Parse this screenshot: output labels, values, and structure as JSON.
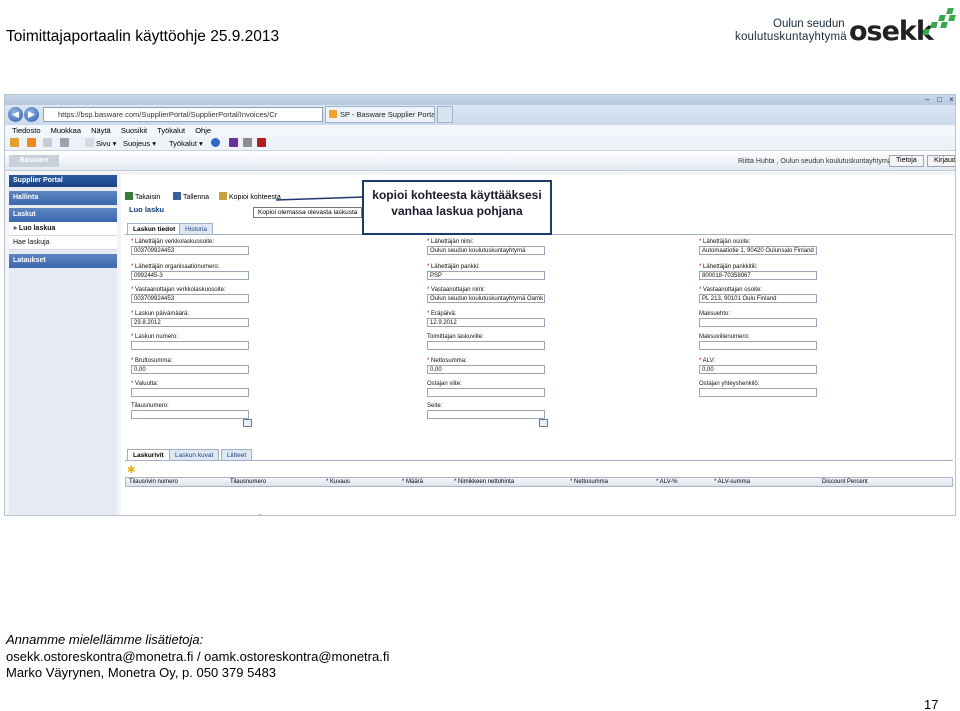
{
  "slide": {
    "header_title": "Toimittajaportaalin käyttöohje 25.9.2013",
    "logo_line1": "Oulun seudun",
    "logo_line2": "koulutuskuntayhtymä",
    "logo_mark": "osekk",
    "callout_line1": "kopioi kohteesta käyttääksesi",
    "callout_line2": "vanhaa laskua pohjana",
    "footer_line1": "Annamme mielellämme lisätietoja:",
    "footer_line2": "osekk.ostoreskontra@monetra.fi  / oamk.ostoreskontra@monetra.fi",
    "footer_line3": "Marko Väyrynen, Monetra Oy, p. 050 379 5483",
    "page_number": "17"
  },
  "browser": {
    "address": "https://bsp.basware.com/SupplierPortal/SupplierPortal/Invoices/Cr",
    "tab1": "SP - Basware Supplier Portal",
    "tab2": "",
    "menu": [
      "Tiedosto",
      "Muokkaa",
      "Näytä",
      "Suosikit",
      "Työkalut",
      "Ohje"
    ],
    "cmd_sivu": "Sivu",
    "cmd_suojeus": "Suojeus",
    "cmd_tyokalut": "Työkalut"
  },
  "app": {
    "brand": "Basware",
    "user_info": "Riitta Huhta , Oulun seudun koulutuskuntayhtymä",
    "btn_tietoja": "Tietoja",
    "btn_kirjaudu": "Kirjaudu",
    "sidebar": {
      "header": "Supplier Portal",
      "hallinta": "Hallinta",
      "laskut": "Laskut",
      "luo_laskua": "» Luo laskua",
      "hae_laskuja": "Hae laskuja",
      "lataukset": "Lataukset"
    },
    "toolbar": {
      "takaisin": "Takaisin",
      "tallenna": "Tallenna",
      "kopioi": "Kopioi kohteesta",
      "tooltip": "Kopioi olemassa olevasta laskusta"
    },
    "page_title": "Luo lasku",
    "tab_laskun_tiedot": "Laskun tiedot",
    "tab_historia": "Historia",
    "fields": {
      "c1": [
        {
          "label": "Lähettäjän verkkolaskuosoite:",
          "req": true,
          "value": "003709924453"
        },
        {
          "label": "Lähettäjän organisaationumero:",
          "req": true,
          "value": "0992445-3"
        },
        {
          "label": "Vastaanottajan verkkolaskuosoite:",
          "req": true,
          "value": "003709924453"
        },
        {
          "label": "Laskun päivämäärä:",
          "req": true,
          "value": "29.8.2012"
        },
        {
          "label": "Laskun numero:",
          "req": true,
          "value": ""
        },
        {
          "label": "Bruttosumma:",
          "req": true,
          "value": "0,00"
        },
        {
          "label": "Valuutta:",
          "req": true,
          "value": ""
        },
        {
          "label": "Tilausnumero:",
          "req": false,
          "value": ""
        }
      ],
      "c2": [
        {
          "label": "Lähettäjän nimi:",
          "req": true,
          "value": "Oulun seudun koulutuskuntayhtymä"
        },
        {
          "label": "Lähettäjän pankki:",
          "req": true,
          "value": "PSP"
        },
        {
          "label": "Vastaanottajan nimi:",
          "req": true,
          "value": "Oulun seudun koulutuskuntayhtymä Oamk"
        },
        {
          "label": "Eräpäivä:",
          "req": true,
          "value": "12.9.2012"
        },
        {
          "label": "Toimittajan laskuviite:",
          "req": false,
          "value": ""
        },
        {
          "label": "Nettosumma:",
          "req": true,
          "value": "0,00"
        },
        {
          "label": "Ostajan viite:",
          "req": false,
          "value": ""
        },
        {
          "label": "Seite:",
          "req": false,
          "value": ""
        }
      ],
      "c3": [
        {
          "label": "Lähettäjän osoite:",
          "req": true,
          "value": "Automaatiotie 1, 90420 Oulunsalo Finland"
        },
        {
          "label": "Lähettäjän pankkitili:",
          "req": true,
          "value": "800018-70358067"
        },
        {
          "label": "Vastaanottajan osoite:",
          "req": true,
          "value": "PL 213, 90101 Oulu Finland"
        },
        {
          "label": "Maksuehto:",
          "req": false,
          "value": ""
        },
        {
          "label": "Maksuviitenumero:",
          "req": false,
          "value": ""
        },
        {
          "label": "ALV:",
          "req": true,
          "value": "0,00"
        },
        {
          "label": "Ostajan yhteyshenkilö:",
          "req": false,
          "value": ""
        }
      ]
    },
    "bottom_tabs": [
      "Laskurivit",
      "Laskun kuvat",
      "Liitteet"
    ],
    "grid_columns": [
      "Tilausrivin numero",
      "Tilausnumero",
      "* Kuvaus",
      "* Määrä",
      "* Nimikkeen nettohinta",
      "* Nettosumma",
      "* ALV-%",
      "* ALV-summa",
      "Discount Percent"
    ]
  },
  "colors": {
    "accent": "#1c4488",
    "required": "#c40000",
    "logo_green": "#38a84a"
  }
}
